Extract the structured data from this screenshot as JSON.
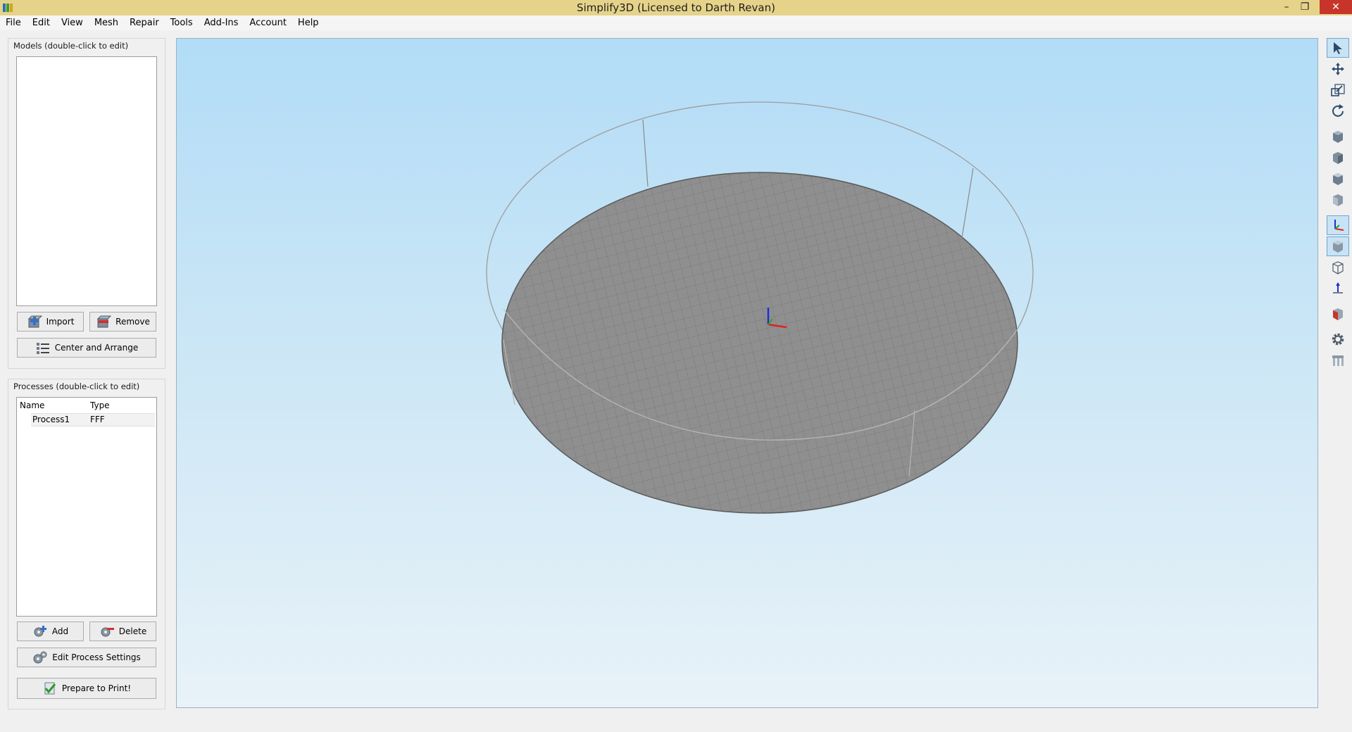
{
  "window": {
    "title": "Simplify3D (Licensed to Darth Revan)",
    "minimize": "–",
    "maximize": "❐",
    "close": "✕"
  },
  "menu": [
    "File",
    "Edit",
    "View",
    "Mesh",
    "Repair",
    "Tools",
    "Add-Ins",
    "Account",
    "Help"
  ],
  "models": {
    "group_label": "Models (double-click to edit)",
    "items": [],
    "import_label": "Import",
    "remove_label": "Remove",
    "center_arrange_label": "Center and Arrange"
  },
  "processes": {
    "group_label": "Processes (double-click to edit)",
    "columns": [
      "Name",
      "Type"
    ],
    "rows": [
      {
        "name": "Process1",
        "type": "FFF"
      }
    ],
    "add_label": "Add",
    "delete_label": "Delete",
    "edit_settings_label": "Edit Process Settings",
    "prepare_label": "Prepare to Print!"
  },
  "toolbar_icons": [
    {
      "name": "select-cursor-icon",
      "active": true
    },
    {
      "name": "move-icon",
      "active": false
    },
    {
      "name": "scale-icon",
      "active": false
    },
    {
      "name": "rotate-icon",
      "active": false
    },
    {
      "name": "view-isometric-cube-icon",
      "active": false
    },
    {
      "name": "view-front-cube-icon",
      "active": false
    },
    {
      "name": "view-top-cube-icon",
      "active": false
    },
    {
      "name": "view-side-cube-icon",
      "active": false
    },
    {
      "name": "show-axes-icon",
      "active": true
    },
    {
      "name": "show-build-volume-icon",
      "active": true
    },
    {
      "name": "wireframe-cube-icon",
      "active": false
    },
    {
      "name": "axis-origin-icon",
      "active": false
    },
    {
      "name": "cross-section-icon",
      "active": false
    },
    {
      "name": "settings-gear-icon",
      "active": false
    },
    {
      "name": "support-structures-icon",
      "active": false
    }
  ],
  "colors": {
    "titlebar": "#e6d38a",
    "close_button": "#c7352a",
    "bed": "#8f8f8f",
    "viewport_top": "#b2dcf7",
    "viewport_bottom": "#e8f2f8"
  }
}
